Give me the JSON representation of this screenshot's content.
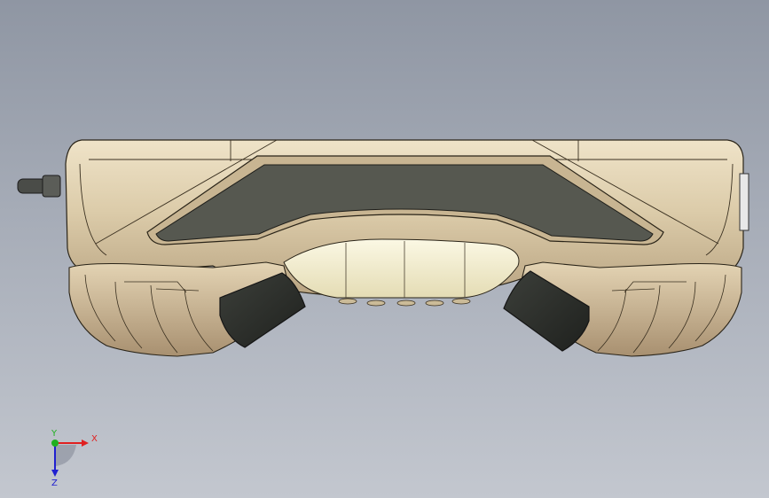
{
  "viewport": {
    "background_top": "#8f96a3",
    "background_bottom": "#c3c7cf",
    "part_color": "#dccdb0",
    "screen_color": "#55574f",
    "button_color": "#2d2f2b",
    "light_panel_color": "#f3efd2"
  },
  "triad": {
    "x_label": "X",
    "y_label": "Y",
    "z_label": "Z",
    "x_color": "#e02020",
    "y_color": "#20b020",
    "z_color": "#2020d0"
  }
}
